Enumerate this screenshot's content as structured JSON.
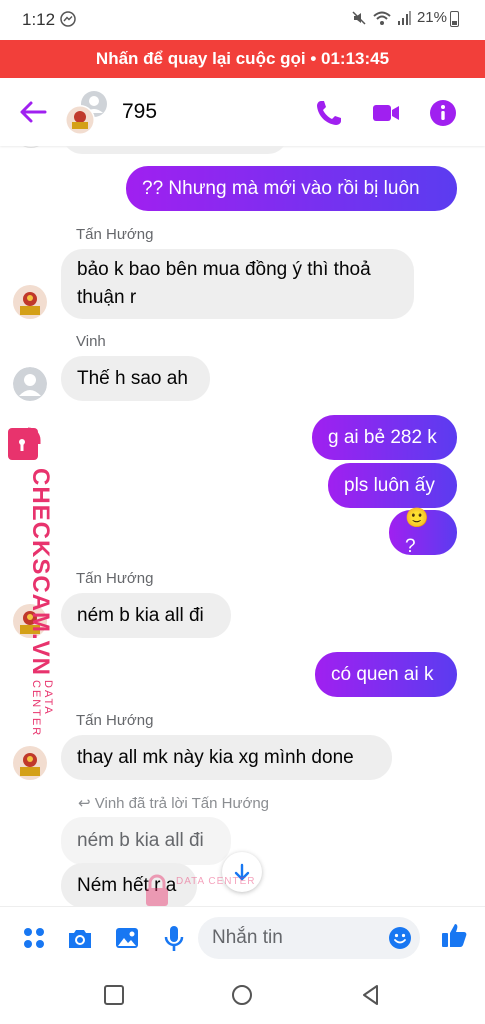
{
  "status_bar": {
    "time": "1:12",
    "battery": "21%"
  },
  "call_banner": {
    "text": "Nhấn để quay lại cuộc gọi • 01:13:45"
  },
  "header": {
    "title": "795"
  },
  "messages": [
    {
      "dir": "out",
      "text": "?? Nhưng mà mới vào rồi bị luôn"
    },
    {
      "sender": "Tấn Hướng",
      "dir": "in",
      "lines": [
        "bảo k bao bên mua đồng ý thì thoả",
        "thuận r"
      ]
    },
    {
      "sender": "Vinh",
      "dir": "in",
      "text": "Thế h sao ah"
    },
    {
      "dir": "out",
      "text": "g ai bẻ 282 k"
    },
    {
      "dir": "out",
      "text": "pls luôn ấy"
    },
    {
      "dir": "out",
      "text": "🙂 ?"
    },
    {
      "sender": "Tấn Hướng",
      "dir": "in",
      "text": "ném b kia all đi"
    },
    {
      "dir": "out",
      "text": "có quen ai k"
    },
    {
      "sender": "Tấn Hướng",
      "dir": "in",
      "text": "thay all mk này kia xg mình done"
    },
    {
      "reply_note": "Vinh đã trả lời Tấn Hướng",
      "quoted": "ném b kia all đi",
      "text": "Ném hết r a"
    }
  ],
  "watermark": {
    "brand": "CHECKSCAM.VN",
    "tagline": "DATA CENTER"
  },
  "composer": {
    "placeholder": "Nhắn tin"
  },
  "colors": {
    "accent": "#a020f0",
    "call_banner": "#f23f3a",
    "bubble_in": "#eeeeee",
    "link_blue": "#1877f2"
  }
}
